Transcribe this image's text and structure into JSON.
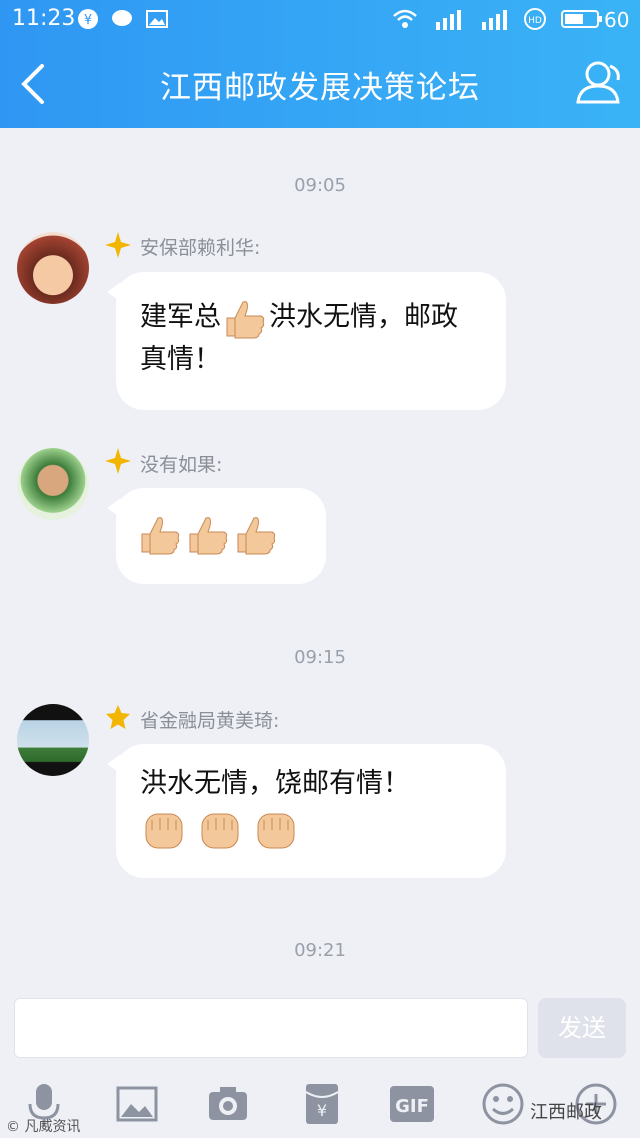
{
  "status": {
    "time": "11:23",
    "battery": "60"
  },
  "nav": {
    "title": "江西邮政发展决策论坛"
  },
  "messages": [
    {
      "time": "09:05",
      "sender": "安保部赖利华:",
      "text1": "建军总",
      "text2": "洪水无情，邮政",
      "text3": "真情！"
    },
    {
      "sender": "没有如果:"
    },
    {
      "time": "09:15",
      "sender": "省金融局黄美琦:",
      "text1": "洪水无情，饶邮有情！"
    }
  ],
  "last_time": "09:21",
  "input": {
    "placeholder": "",
    "send_label": "发送"
  },
  "watermark": {
    "left": "© 凡威资讯",
    "right": "江西邮政"
  },
  "colors": {
    "accent": "#2f97f3",
    "bubble": "#ffffff",
    "bg": "#eef0f6"
  },
  "tools": [
    "mic-icon",
    "image-icon",
    "camera-icon",
    "red-packet-icon",
    "gif-icon",
    "emoji-icon",
    "plus-icon"
  ]
}
